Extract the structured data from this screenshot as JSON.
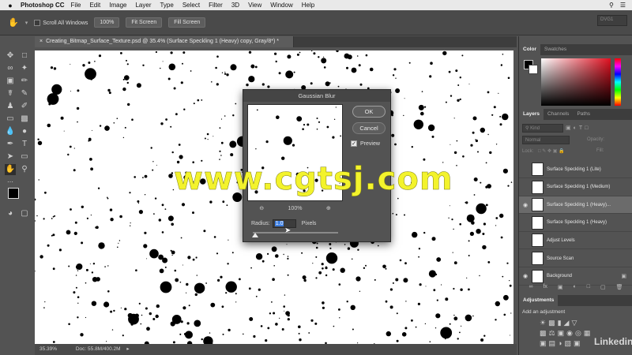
{
  "menubar": {
    "apple": "",
    "app": "Photoshop CC",
    "items": [
      "File",
      "Edit",
      "Image",
      "Layer",
      "Type",
      "Select",
      "Filter",
      "3D",
      "View",
      "Window",
      "Help"
    ]
  },
  "options": {
    "scroll_all_windows": "Scroll All Windows",
    "zoom_100": "100%",
    "fit_screen": "Fit Screen",
    "fill_screen": "Fill Screen",
    "workspace": "DVG1"
  },
  "document": {
    "tab_title": "Creating_Bitmap_Surface_Texture.psd @ 35.4% (Surface Speckling 1 (Heavy) copy, Gray/8*) *",
    "zoom": "35.39%",
    "doc_size": "Doc: 55.8M/400.2M"
  },
  "dialog": {
    "title": "Gaussian Blur",
    "ok": "OK",
    "cancel": "Cancel",
    "preview_label": "Preview",
    "preview_checked": true,
    "zoom": "100%",
    "radius_label": "Radius:",
    "radius_value": "1.0",
    "radius_unit": "Pixels"
  },
  "panels": {
    "color_tabs": [
      "Color",
      "Swatches"
    ],
    "layers_tabs": [
      "Layers",
      "Channels",
      "Paths"
    ],
    "kind_label": "Kind",
    "blend_mode": "Normal",
    "opacity_label": "Opacity:",
    "lock_label": "Lock:",
    "fill_label": "Fill:",
    "layers": [
      {
        "name": "Surface Speckling 1 (Lite)",
        "visible": false,
        "selected": false
      },
      {
        "name": "Surface Speckling 1 (Medium)",
        "visible": false,
        "selected": false
      },
      {
        "name": "Surface Speckling 1 (Heavy)...",
        "visible": true,
        "selected": true
      },
      {
        "name": "Surface Speckling 1 (Heavy)",
        "visible": false,
        "selected": false
      },
      {
        "name": "Adjust Levels",
        "visible": false,
        "selected": false
      },
      {
        "name": "Source Scan",
        "visible": false,
        "selected": false
      },
      {
        "name": "Background",
        "visible": true,
        "selected": false
      }
    ],
    "adjustments_tab": "Adjustments",
    "add_adjustment": "Add an adjustment"
  },
  "watermark": "www.cgtsj.com",
  "branding": "Linkedin",
  "colors": {
    "ui_bg": "#535353",
    "panel_dark": "#3d3d3d",
    "watermark": "#f3f32c"
  }
}
